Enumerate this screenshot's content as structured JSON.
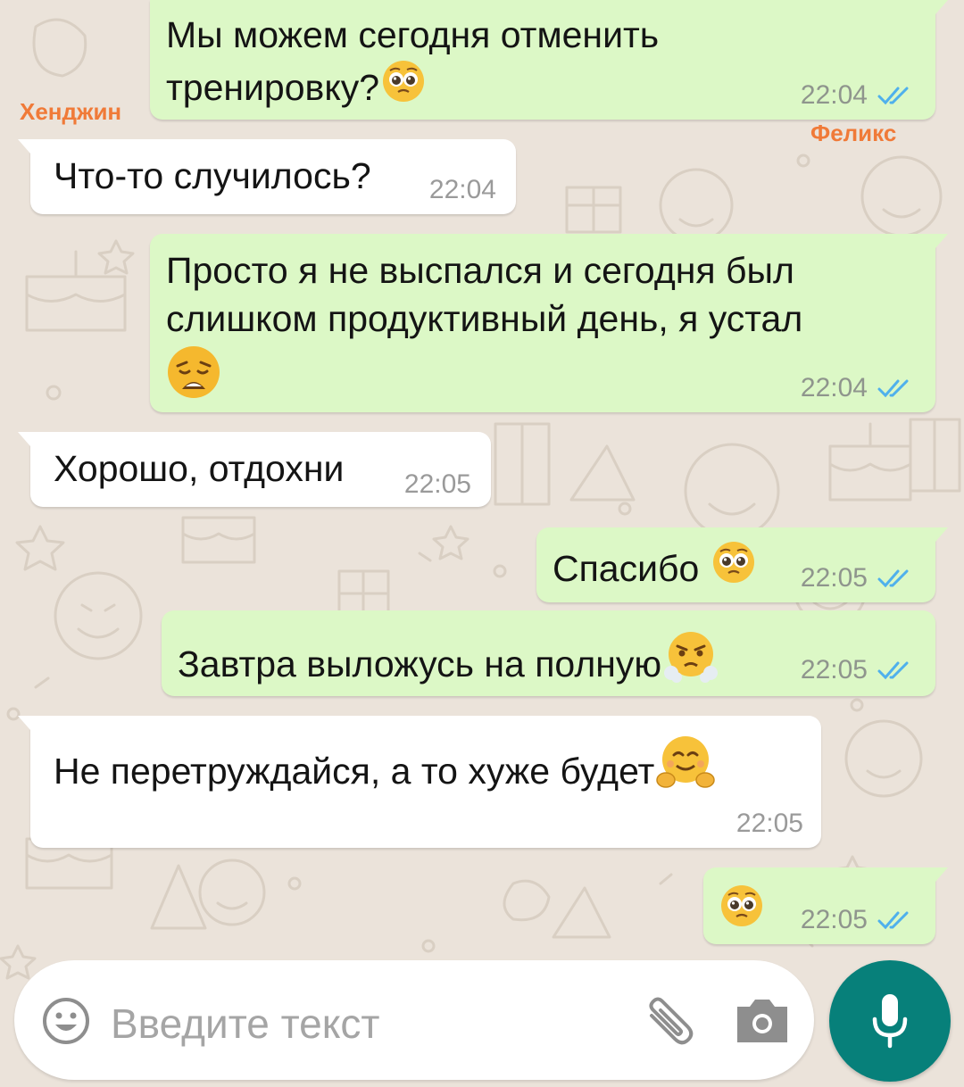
{
  "chat": {
    "sender_names": {
      "left": "Хенджин",
      "right": "Феликс"
    },
    "messages": [
      {
        "direction": "out",
        "lines": [
          "Мы можем сегодня отменить",
          "тренировку?"
        ],
        "emoji": "pleading-face",
        "time": "22:04",
        "status": "read"
      },
      {
        "direction": "in",
        "lines": [
          "Что-то случилось?"
        ],
        "time": "22:04"
      },
      {
        "direction": "out",
        "lines": [
          "Просто я не выспался и сегодня был",
          "слишком продуктивный день, я устал"
        ],
        "emoji": "weary-face",
        "time": "22:04",
        "status": "read"
      },
      {
        "direction": "in",
        "lines": [
          "Хорошо, отдохни"
        ],
        "time": "22:05"
      },
      {
        "direction": "out",
        "lines": [
          "Спасибо"
        ],
        "emoji": "pleading-face",
        "time": "22:05",
        "status": "read"
      },
      {
        "direction": "out",
        "lines": [
          "Завтра выложусь на полную"
        ],
        "emoji": "face-with-steam-from-nose",
        "time": "22:05",
        "status": "read"
      },
      {
        "direction": "in",
        "lines": [
          "Не перетруждайся, а то хуже будет"
        ],
        "emoji": "hugging-face",
        "time": "22:05"
      },
      {
        "direction": "out",
        "lines": [
          ""
        ],
        "emoji": "pleading-face",
        "time": "22:05",
        "status": "read"
      }
    ]
  },
  "composer": {
    "placeholder": "Введите текст",
    "icons": [
      "emoji-icon",
      "paperclip-icon",
      "camera-icon",
      "microphone-icon"
    ]
  },
  "colors": {
    "wallpaper": "#ebe3da",
    "outgoing_bubble": "#dcf8c6",
    "incoming_bubble": "#ffffff",
    "read_ticks": "#4fb0ec",
    "name_tag": "#f07a38",
    "mic_button": "#07807a"
  }
}
